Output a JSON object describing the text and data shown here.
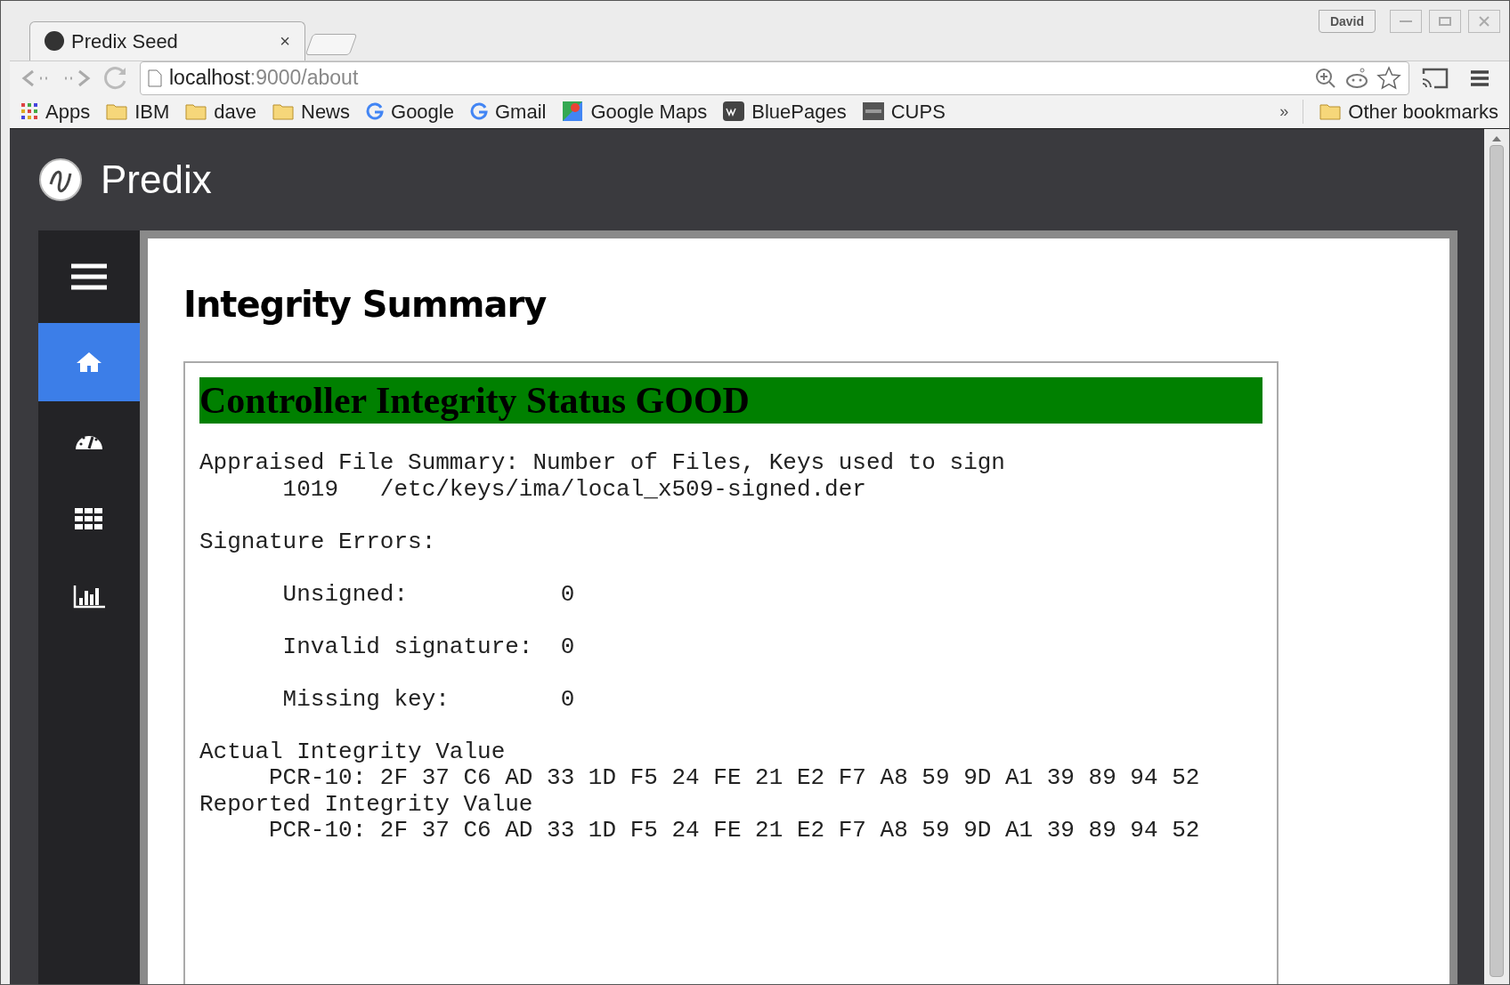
{
  "browser": {
    "tab_title": "Predix Seed",
    "tab_close": "×",
    "profile": "David",
    "address_host": "localhost",
    "address_rest": ":9000/about",
    "bookmarks": [
      {
        "kind": "apps",
        "label": "Apps"
      },
      {
        "kind": "folder",
        "label": "IBM"
      },
      {
        "kind": "folder",
        "label": "dave"
      },
      {
        "kind": "folder",
        "label": "News"
      },
      {
        "kind": "google",
        "label": "Google"
      },
      {
        "kind": "google",
        "label": "Gmail"
      },
      {
        "kind": "maps",
        "label": "Google Maps"
      },
      {
        "kind": "w3",
        "label": "BluePages"
      },
      {
        "kind": "cups",
        "label": "CUPS"
      }
    ],
    "overflow": "»",
    "other_bookmarks": "Other bookmarks"
  },
  "app": {
    "brand": "Predix",
    "nav": [
      {
        "kind": "menu",
        "selected": false
      },
      {
        "kind": "home",
        "selected": true
      },
      {
        "kind": "dashboard",
        "selected": false
      },
      {
        "kind": "grid",
        "selected": false
      },
      {
        "kind": "chart",
        "selected": false
      }
    ]
  },
  "page": {
    "title": "Integrity Summary",
    "status": "Controller Integrity Status GOOD",
    "report_blocks": [
      [
        "Appraised File Summary: Number of Files, Keys used to sign",
        "      1019   /etc/keys/ima/local_x509-signed.der"
      ],
      [
        "Signature Errors:"
      ],
      [
        "      Unsigned:           0"
      ],
      [
        "      Invalid signature:  0"
      ],
      [
        "      Missing key:        0"
      ],
      [
        "Actual Integrity Value",
        "     PCR-10: 2F 37 C6 AD 33 1D F5 24 FE 21 E2 F7 A8 59 9D A1 39 89 94 52",
        "Reported Integrity Value",
        "     PCR-10: 2F 37 C6 AD 33 1D F5 24 FE 21 E2 F7 A8 59 9D A1 39 89 94 52"
      ]
    ]
  }
}
